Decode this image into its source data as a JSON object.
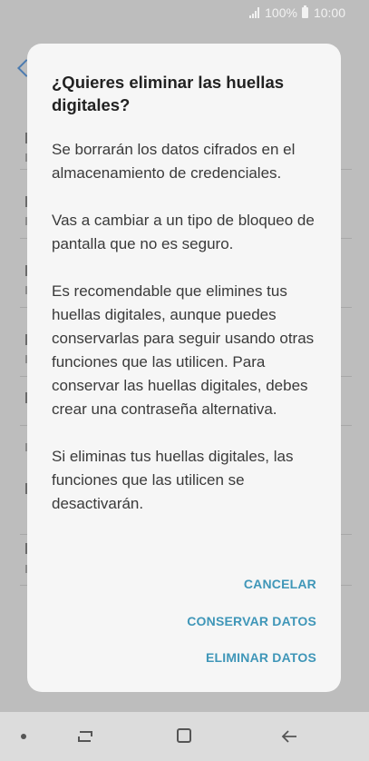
{
  "status_bar": {
    "battery_percent": "100%",
    "time": "10:00"
  },
  "dialog": {
    "title": "¿Quieres eliminar las huellas digitales?",
    "paragraphs": [
      "Se borrarán los datos cifrados en el almacenamiento de credenciales.",
      "Vas a cambiar a un tipo de bloqueo de pantalla que no es seguro.",
      "Es recomendable que elimines tus huellas digitales, aunque puedes conservarlas para seguir usando otras funciones que las utilicen. Para conservar las huellas digitales, debes crear una contraseña alternativa.",
      "Si eliminas tus huellas digitales, las funciones que las utilicen se desactivarán."
    ],
    "buttons": {
      "cancel": "CANCELAR",
      "keep": "CONSERVAR DATOS",
      "delete": "ELIMINAR DATOS"
    }
  },
  "colors": {
    "accent": "#3f96b8",
    "scrim": "#bdbdbd",
    "dialog_bg": "#f6f6f6"
  },
  "icons": [
    "signal-icon",
    "battery-icon",
    "back-arrow-icon",
    "recent-apps-icon",
    "home-icon",
    "nav-back-icon"
  ]
}
